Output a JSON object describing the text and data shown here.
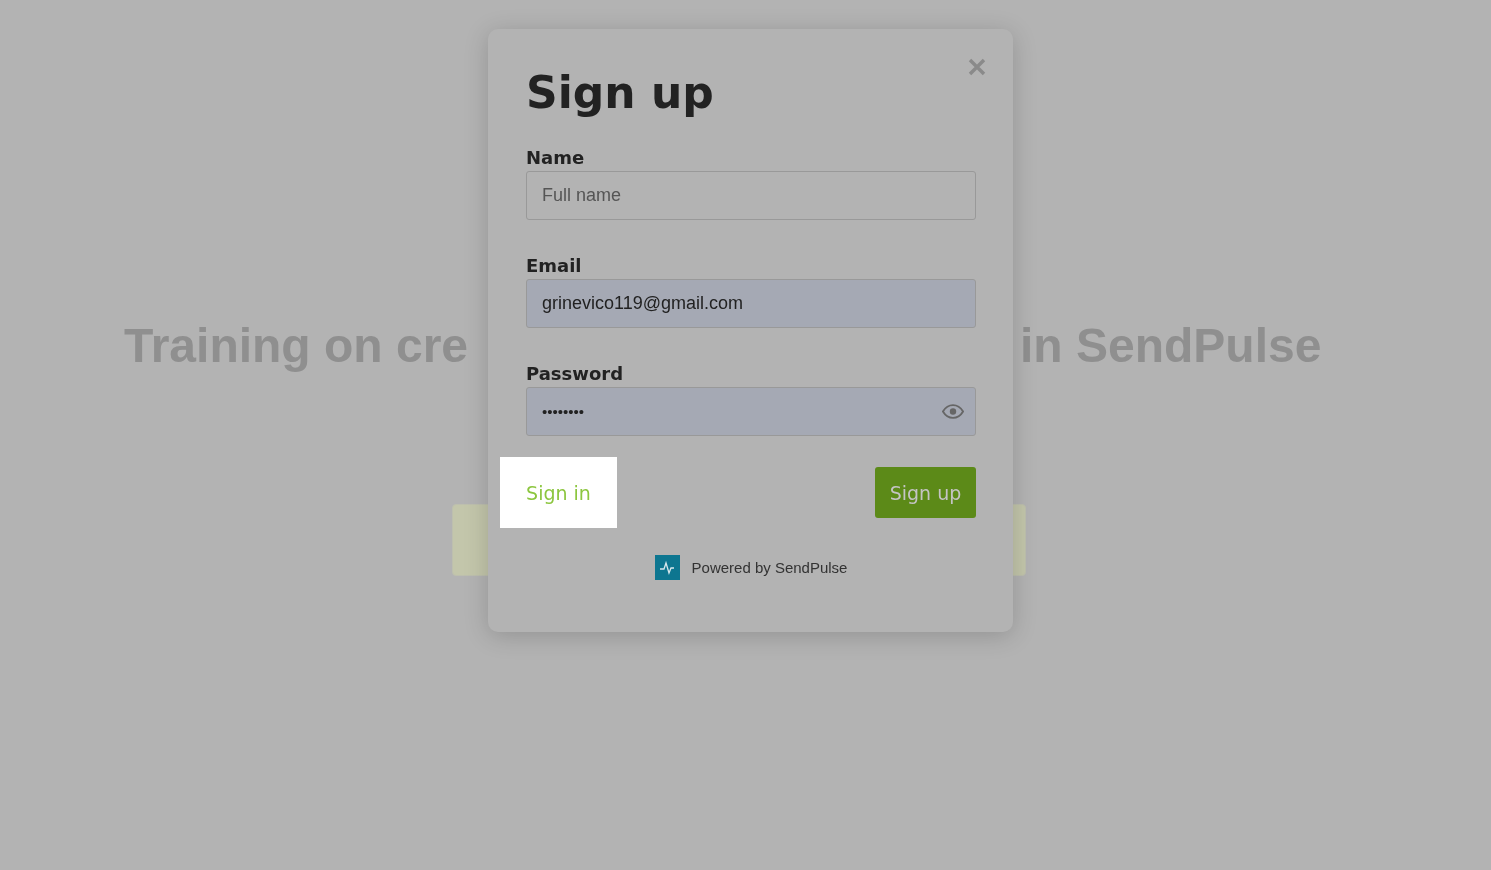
{
  "page": {
    "heading_parts": [
      "Training on cre",
      "in SendPulse"
    ]
  },
  "modal": {
    "title": "Sign up",
    "fields": [
      {
        "kind": "text",
        "label": "Name",
        "placeholder": "Full name",
        "autofilled": false
      },
      {
        "kind": "email",
        "label": "Email",
        "value": "grinevico119@gmail.com",
        "autofilled": true
      },
      {
        "kind": "password",
        "label": "Password",
        "value": "••••••••",
        "autofilled": true
      }
    ],
    "sign_in_link": "Sign in",
    "sign_up_button": "Sign up",
    "footer": "Powered by SendPulse"
  }
}
